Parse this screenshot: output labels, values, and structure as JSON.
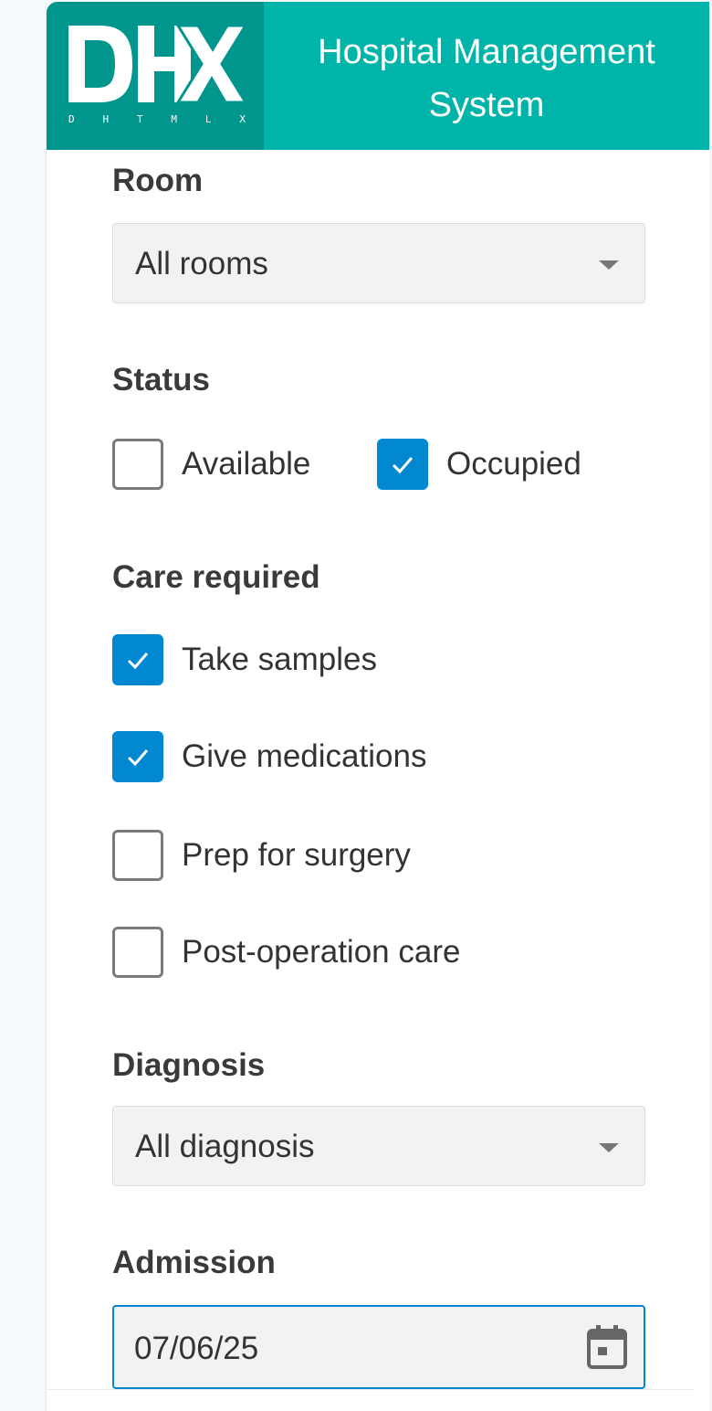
{
  "header": {
    "logo_text": "DHX",
    "logo_subtitle": [
      "D",
      "H",
      "T",
      "M",
      "L",
      "X"
    ],
    "title_line1": "Hospital Management",
    "title_line2": "System"
  },
  "filters": {
    "room": {
      "label": "Room",
      "value": "All rooms"
    },
    "status": {
      "label": "Status",
      "options": [
        {
          "label": "Available",
          "checked": false
        },
        {
          "label": "Occupied",
          "checked": true
        }
      ]
    },
    "care_required": {
      "label": "Care required",
      "options": [
        {
          "label": "Take samples",
          "checked": true
        },
        {
          "label": "Give medications",
          "checked": true
        },
        {
          "label": "Prep for surgery",
          "checked": false
        },
        {
          "label": "Post-operation care",
          "checked": false
        }
      ]
    },
    "diagnosis": {
      "label": "Diagnosis",
      "value": "All diagnosis"
    },
    "admission": {
      "label": "Admission",
      "value": "07/06/25"
    }
  },
  "colors": {
    "header": "#00b4aa",
    "logo_bg": "#00968e",
    "accent": "#0288d1"
  },
  "icons": {
    "dropdown": "chevron-down-icon",
    "checkmark": "check-icon",
    "calendar": "calendar-icon"
  }
}
